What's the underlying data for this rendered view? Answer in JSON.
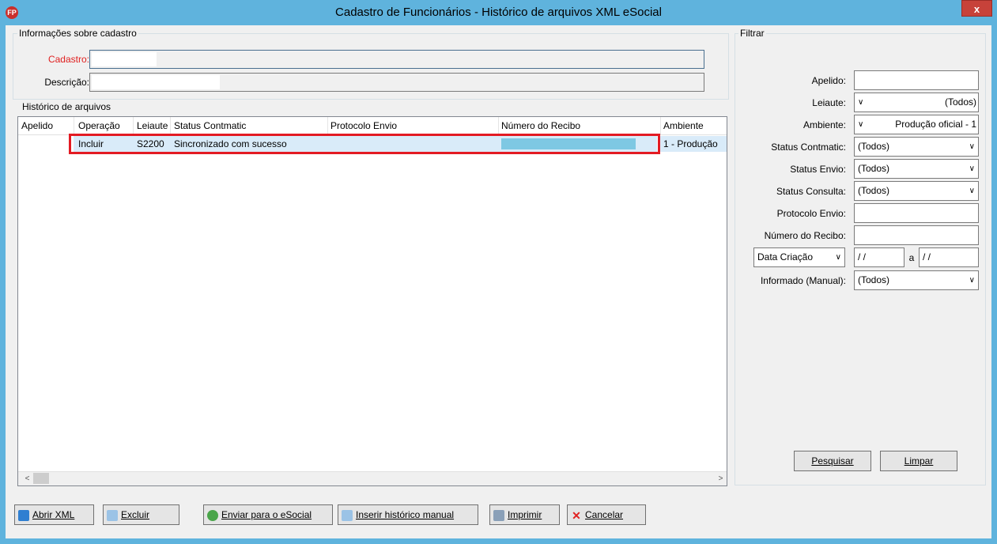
{
  "window": {
    "title": "Cadastro de Funcionários - Histórico de arquivos XML eSocial",
    "logo": "FP",
    "close_label": "x",
    "colors": {
      "titlebar": "#5fb3dd",
      "close": "#c7423a",
      "highlight": "#e31b23",
      "selection": "#d9ebf9"
    }
  },
  "info_group": {
    "title": "Informações sobre cadastro",
    "cadastro_label": "Cadastro:",
    "descricao_label": "Descrição:"
  },
  "historico_group": {
    "title": "Histórico de arquivos",
    "columns": [
      "Apelido",
      "Operação",
      "Leiaute",
      "Status Contmatic",
      "Protocolo Envio",
      "Número do Recibo",
      "Ambiente"
    ],
    "rows": [
      {
        "apelido": "",
        "operacao": "Incluir",
        "leiaute": "S2200",
        "status": "Sincronizado com sucesso",
        "protocolo": "",
        "recibo": "",
        "ambiente": "1 - Produção"
      }
    ],
    "scroll_left": "<",
    "scroll_right": ">"
  },
  "filtrar": {
    "title": "Filtrar",
    "apelido_label": "Apelido:",
    "leiaute_label": "Leiaute:",
    "leiaute_value": "(Todos)",
    "ambiente_label": "Ambiente:",
    "ambiente_value": "Produção oficial - 1",
    "status_contmatic_label": "Status Contmatic:",
    "status_contmatic_value": "(Todos)",
    "status_envio_label": "Status Envio:",
    "status_envio_value": "(Todos)",
    "status_consulta_label": "Status Consulta:",
    "status_consulta_value": "(Todos)",
    "protocolo_label": "Protocolo Envio:",
    "recibo_label": "Número do Recibo:",
    "data_select": "Data Criação",
    "data_from": "/ /",
    "data_sep": "a",
    "data_to": "/ /",
    "informado_label": "Informado (Manual):",
    "informado_value": "(Todos)",
    "pesquisar": "Pesquisar",
    "limpar": "Limpar"
  },
  "buttons": {
    "abrir_xml": "Abrir XML",
    "excluir": "Excluir",
    "enviar": "Enviar para o eSocial",
    "inserir": "Inserir histórico manual",
    "imprimir": "Imprimir",
    "cancelar": "Cancelar"
  },
  "icons": {
    "abrir": "xml-icon",
    "excluir": "document-delete-icon",
    "enviar": "globe-send-icon",
    "inserir": "document-add-icon",
    "imprimir": "printer-icon",
    "cancelar": "red-x-icon"
  }
}
